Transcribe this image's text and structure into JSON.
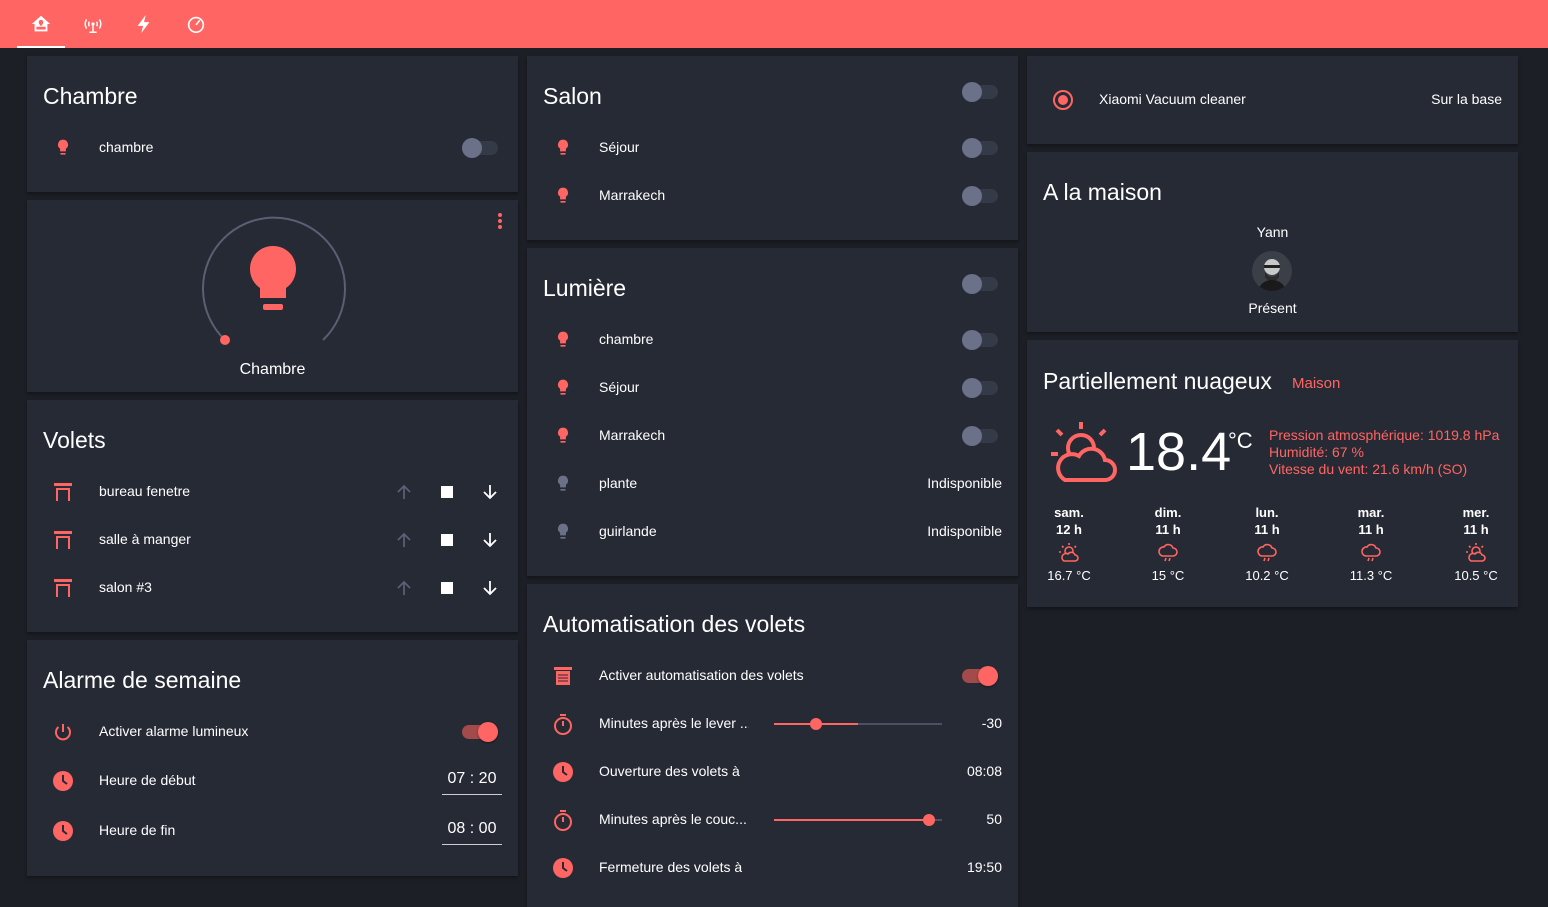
{
  "colors": {
    "accent": "#ff6562",
    "card": "#262a35",
    "background": "#1c1f26",
    "off": "#6b7189"
  },
  "tabs": [
    {
      "icon": "home-icon",
      "active": true
    },
    {
      "icon": "antenna-icon",
      "active": false
    },
    {
      "icon": "lightning-icon",
      "active": false
    },
    {
      "icon": "speedometer-icon",
      "active": false
    }
  ],
  "chambre_card": {
    "title": "Chambre",
    "rows": [
      {
        "icon": "lightbulb-icon",
        "label": "chambre",
        "toggle": "off"
      }
    ]
  },
  "light_card": {
    "name": "Chambre",
    "icon": "lightbulb-icon",
    "menu_icon": "dots-vertical-icon"
  },
  "volets_card": {
    "title": "Volets",
    "rows": [
      {
        "icon": "window-shutter-icon",
        "label": "bureau fenetre"
      },
      {
        "icon": "window-shutter-icon",
        "label": "salle à manger"
      },
      {
        "icon": "window-shutter-icon",
        "label": "salon #3"
      }
    ]
  },
  "alarme_card": {
    "title": "Alarme de semaine",
    "rows": [
      {
        "icon": "power-icon",
        "label": "Activer alarme lumineux",
        "toggle": "on"
      },
      {
        "icon": "clock-icon",
        "label": "Heure de début",
        "value": "07 : 20"
      },
      {
        "icon": "clock-icon",
        "label": "Heure de fin",
        "value": "08 : 00"
      }
    ]
  },
  "salon_card": {
    "title": "Salon",
    "header_toggle": "off",
    "rows": [
      {
        "icon": "lightbulb-icon",
        "label": "Séjour",
        "toggle": "off"
      },
      {
        "icon": "lightbulb-icon",
        "label": "Marrakech",
        "toggle": "off"
      }
    ]
  },
  "lumiere_card": {
    "title": "Lumière",
    "header_toggle": "off",
    "rows": [
      {
        "icon": "lightbulb-icon",
        "label": "chambre",
        "toggle": "off"
      },
      {
        "icon": "lightbulb-icon",
        "label": "Séjour",
        "toggle": "off"
      },
      {
        "icon": "lightbulb-icon",
        "label": "Marrakech",
        "toggle": "off"
      },
      {
        "icon": "lightbulb-icon",
        "label": "plante",
        "value": "Indisponible"
      },
      {
        "icon": "lightbulb-icon",
        "label": "guirlande",
        "value": "Indisponible"
      }
    ]
  },
  "automation_card": {
    "title": "Automatisation des volets",
    "rows": [
      {
        "icon": "window-shutter-icon",
        "label": "Activer automatisation des volets",
        "toggle": "on"
      },
      {
        "icon": "timer-icon",
        "label": "Minutes après le lever ...",
        "value": "-30",
        "slider_fraction": 0.25
      },
      {
        "icon": "clock-icon",
        "label": "Ouverture des volets à",
        "value": "08:08"
      },
      {
        "icon": "timer-icon",
        "label": "Minutes après le couc...",
        "value": "50",
        "slider_fraction": 0.92
      },
      {
        "icon": "clock-icon",
        "label": "Fermeture des volets à",
        "value": "19:50"
      }
    ]
  },
  "vacuum_card": {
    "icon": "robot-vacuum-icon",
    "label": "Xiaomi Vacuum cleaner",
    "status": "Sur la base"
  },
  "home_card": {
    "title": "A la maison",
    "person_name": "Yann",
    "person_state": "Présent"
  },
  "weather_card": {
    "condition": "Partiellement nuageux",
    "location": "Maison",
    "temperature": "18.4",
    "unit": "°C",
    "pressure": "Pression atmosphérique: 1019.8 hPa",
    "humidity": "Humidité: 67 %",
    "wind": "Vitesse du vent: 21.6 km/h (SO)",
    "forecast": [
      {
        "day": "sam.",
        "hour": "12 h",
        "icon": "partly-cloudy-icon",
        "temp": "16.7 °C"
      },
      {
        "day": "dim.",
        "hour": "11 h",
        "icon": "rainy-icon",
        "temp": "15 °C"
      },
      {
        "day": "lun.",
        "hour": "11 h",
        "icon": "rainy-icon",
        "temp": "10.2 °C"
      },
      {
        "day": "mar.",
        "hour": "11 h",
        "icon": "rainy-icon",
        "temp": "11.3 °C"
      },
      {
        "day": "mer.",
        "hour": "11 h",
        "icon": "partly-cloudy-icon",
        "temp": "10.5 °C"
      }
    ]
  }
}
